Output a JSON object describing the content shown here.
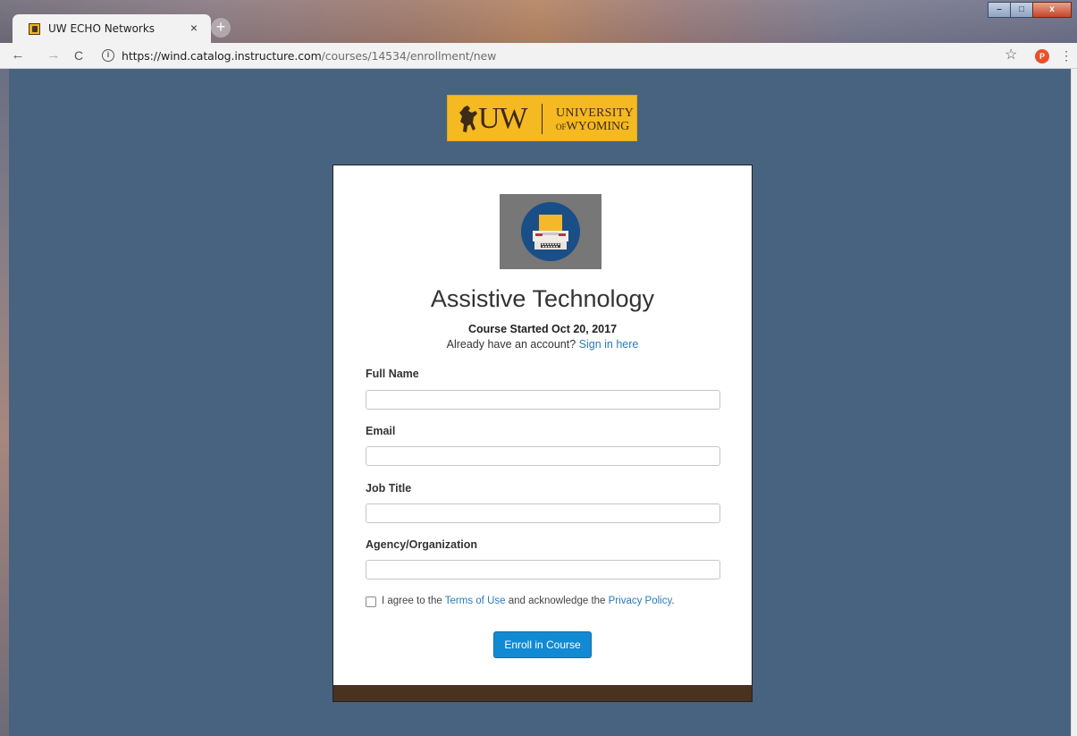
{
  "browser": {
    "tab_title": "UW ECHO Networks",
    "tab_close": "×",
    "new_tab": "+",
    "url_host": "https://wind.catalog.instructure.com",
    "url_path": "/courses/14534/enrollment/new",
    "profile_initial": "P",
    "window_controls": {
      "minimize": "–",
      "maximize": "□",
      "close": "x"
    }
  },
  "logo": {
    "letters": "UW",
    "line1": "UNIVERSITY",
    "line2_prefix": "OF",
    "line2": "WYOMING"
  },
  "course": {
    "title": "Assistive Technology",
    "started": "Course Started Oct 20, 2017",
    "already_text": "Already have an account?",
    "sign_in_link": "Sign in here"
  },
  "form": {
    "full_name_label": "Full Name",
    "full_name_value": "",
    "email_label": "Email",
    "email_value": "",
    "job_title_label": "Job Title",
    "job_title_value": "",
    "agency_label": "Agency/Organization",
    "agency_value": "",
    "agree_prefix": "I agree to the",
    "terms_link": "Terms of Use",
    "agree_middle": "and acknowledge the",
    "privacy_link": "Privacy Policy",
    "agree_suffix": ".",
    "submit_label": "Enroll in Course"
  },
  "colors": {
    "page_background": "#486380",
    "logo_gold": "#f5b921",
    "card_footer_brown": "#4a3221",
    "button_blue": "#1289d3",
    "link_blue": "#2a7ab8"
  }
}
